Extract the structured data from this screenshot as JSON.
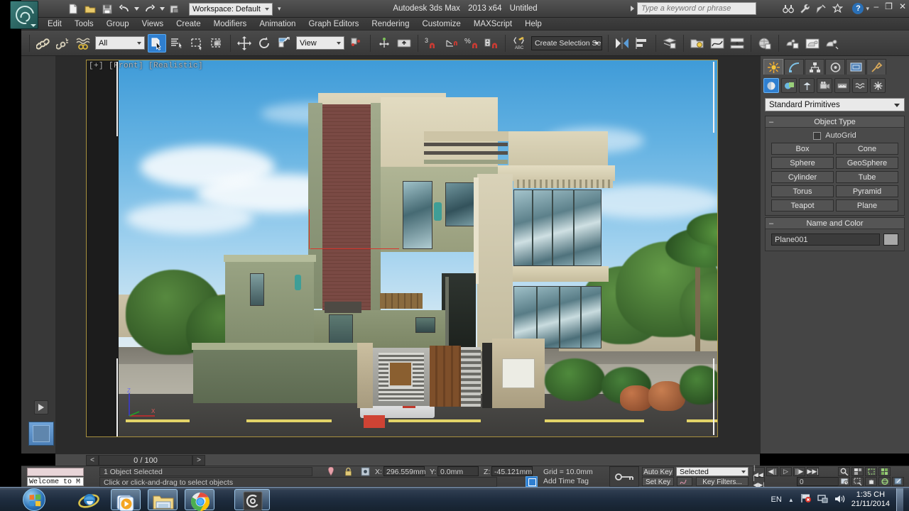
{
  "app": {
    "title_parts": [
      "Autodesk 3ds Max",
      "2013 x64",
      "Untitled"
    ],
    "workspace_label": "Workspace: Default",
    "search_placeholder": "Type a keyword or phrase",
    "help_label": "?",
    "minimize_label": "–",
    "restore_label": "❐",
    "close_label": "✕"
  },
  "menu": {
    "items": [
      "Edit",
      "Tools",
      "Group",
      "Views",
      "Create",
      "Modifiers",
      "Animation",
      "Graph Editors",
      "Rendering",
      "Customize",
      "MAXScript",
      "Help"
    ]
  },
  "toolbar": {
    "selection_filter": "All",
    "reference_coord": "View",
    "named_selection_set": "Create Selection Se",
    "icons": [
      "select-and-link-icon",
      "unlink-selection-icon",
      "bind-to-space-warp-icon",
      "select-object-icon",
      "select-by-name-icon",
      "rectangular-select-region-icon",
      "window-crossing-icon",
      "select-and-move-icon",
      "select-and-rotate-icon",
      "select-and-uniform-scale-icon",
      "use-center-flyout-icon",
      "select-and-manipulate-icon",
      "snaps-toggle-icon",
      "angle-snap-toggle-icon",
      "percent-snap-toggle-icon",
      "spinner-snap-toggle-icon",
      "edit-named-selection-sets-icon",
      "mirror-icon",
      "align-icon",
      "layer-manager-icon",
      "curve-editor-icon",
      "schematic-view-icon",
      "material-editor-icon",
      "render-setup-icon",
      "rendered-frame-window-icon",
      "render-production-icon"
    ]
  },
  "viewport": {
    "label": "[+] [Front] [Realistic]",
    "axis_labels": {
      "z": "Z",
      "x": "X"
    }
  },
  "timebar": {
    "prev_label": "<",
    "frame_readout": "0 / 100",
    "next_label": ">"
  },
  "status": {
    "minilistener_text": "Welcome to M",
    "selection_status": "1 Object Selected",
    "prompt": "Click or click-and-drag to select objects",
    "coords": [
      {
        "label": "X:",
        "value": "296.559mm"
      },
      {
        "label": "Y:",
        "value": "0.0mm"
      },
      {
        "label": "Z:",
        "value": "-45.121mm"
      }
    ],
    "grid_text": "Grid = 10.0mm",
    "add_time_tag": "Add Time Tag",
    "auto_key": "Auto Key",
    "set_key": "Set Key",
    "key_mode": "Selected",
    "key_filters": "Key Filters...",
    "frame_value": "0",
    "icons": [
      "isolate-selection-icon",
      "lock-selection-icon",
      "absolute-relative-transform-icon",
      "key-mode-toggle-icon",
      "go-to-start-icon",
      "previous-frame-icon",
      "play-animation-icon",
      "next-frame-icon",
      "go-to-end-icon",
      "zoom-icon",
      "zoom-all-icon",
      "zoom-extents-icon",
      "zoom-extents-all-icon",
      "field-of-view-icon",
      "pan-view-icon",
      "orbit-icon",
      "maximize-viewport-toggle-icon"
    ]
  },
  "command_panel": {
    "tabs": [
      "create-tab",
      "modify-tab",
      "hierarchy-tab",
      "motion-tab",
      "display-tab",
      "utilities-tab"
    ],
    "categories": [
      "geometry-icon",
      "shapes-icon",
      "lights-icon",
      "cameras-icon",
      "helpers-icon",
      "space-warps-icon",
      "systems-icon"
    ],
    "primitive_type": "Standard Primitives",
    "object_type": {
      "header": "Object Type",
      "autogrid_label": "AutoGrid",
      "buttons": [
        "Box",
        "Cone",
        "Sphere",
        "GeoSphere",
        "Cylinder",
        "Tube",
        "Torus",
        "Pyramid",
        "Teapot",
        "Plane"
      ]
    },
    "name_and_color": {
      "header": "Name and Color",
      "name": "Plane001",
      "swatch_color": "#a8a8a8"
    }
  },
  "taskbar": {
    "start_label": "start-orb",
    "buttons": [
      "internet-explorer-icon",
      "media-player-icon",
      "file-explorer-icon",
      "google-chrome-icon",
      "3ds-max-icon"
    ],
    "tray": {
      "language": "EN",
      "icons": [
        "show-hidden-icons-icon",
        "security-flag-icon",
        "network-icon",
        "volume-icon"
      ],
      "time": "1:35 CH",
      "date": "21/11/2014"
    }
  }
}
